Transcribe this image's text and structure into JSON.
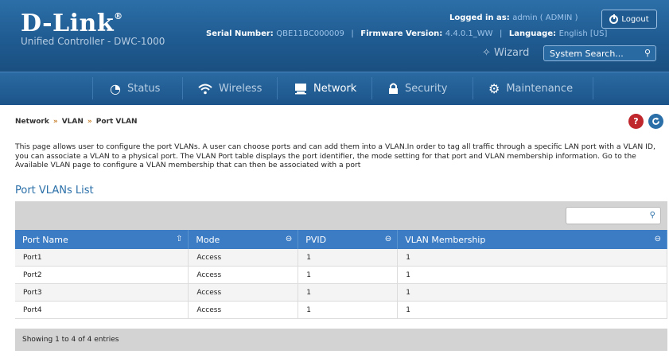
{
  "header": {
    "brand": "D-Link",
    "brand_mark": "®",
    "subtitle": "Unified Controller - DWC-1000",
    "login_label": "Logged in as:",
    "login_value": "admin ( ADMIN )",
    "logout_label": "Logout",
    "serial_label": "Serial Number:",
    "serial_value": "QBE11BC000009",
    "firmware_label": "Firmware Version:",
    "firmware_value": "4.4.0.1_WW",
    "language_label": "Language:",
    "language_value": "English [US]",
    "separator": "|",
    "wizard_label": "Wizard",
    "search_placeholder": "System Search..."
  },
  "nav": {
    "items": [
      {
        "label": "Status",
        "icon": "speedometer-icon"
      },
      {
        "label": "Wireless",
        "icon": "wifi-icon"
      },
      {
        "label": "Network",
        "icon": "monitor-icon",
        "active": true
      },
      {
        "label": "Security",
        "icon": "lock-icon"
      },
      {
        "label": "Maintenance",
        "icon": "gears-icon"
      }
    ]
  },
  "breadcrumb": {
    "items": [
      "Network",
      "VLAN",
      "Port VLAN"
    ],
    "separator": "»"
  },
  "help": {
    "help_label": "?"
  },
  "description": "This page allows user to configure the port VLANs. A user can choose ports and can add them into a VLAN.In order to tag all traffic through a specific LAN port with a VLAN ID, you can associate a VLAN to a physical port. The VLAN Port table displays the port identifier, the mode setting for that port and VLAN membership information. Go to the Available VLAN page to configure a VLAN membership that can then be associated with a port",
  "list": {
    "title": "Port VLANs List",
    "columns": [
      "Port Name",
      "Mode",
      "PVID",
      "VLAN Membership"
    ],
    "rows": [
      [
        "Port1",
        "Access",
        "1",
        "1"
      ],
      [
        "Port2",
        "Access",
        "1",
        "1"
      ],
      [
        "Port3",
        "Access",
        "1",
        "1"
      ],
      [
        "Port4",
        "Access",
        "1",
        "1"
      ]
    ],
    "footer": "Showing 1 to 4 of 4 entries"
  },
  "colors": {
    "header_blue": "#1f5b91",
    "table_header": "#3b7cc4",
    "accent_orange": "#c47a22"
  }
}
